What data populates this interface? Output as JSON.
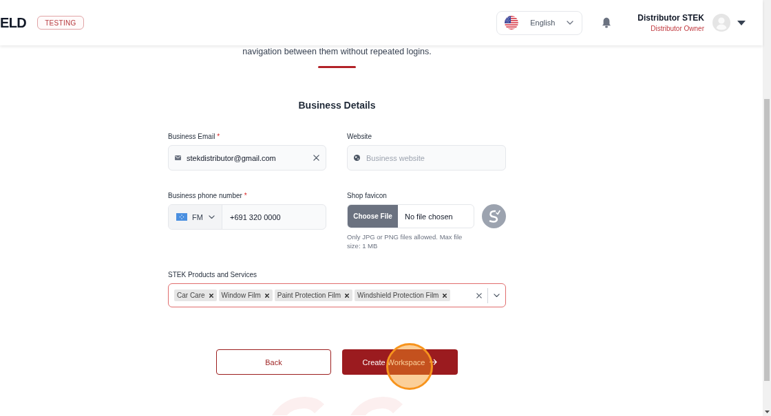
{
  "header": {
    "logo_text": "ELD",
    "environment_badge": "TESTING",
    "language": {
      "label": "English"
    },
    "user": {
      "name": "Distributor STEK",
      "role": "Distributor Owner"
    }
  },
  "intro": {
    "text": "navigation between them without repeated logins."
  },
  "section": {
    "title": "Business Details"
  },
  "email": {
    "label": "Business Email",
    "required_mark": "*",
    "value": "stekdistributor@gmail.com"
  },
  "website": {
    "label": "Website",
    "placeholder": "Business website"
  },
  "phone": {
    "label": "Business phone number",
    "required_mark": "*",
    "country": "FM",
    "value": "+691 320 0000"
  },
  "favicon": {
    "label": "Shop favicon",
    "button": "Choose File",
    "status": "No file chosen",
    "hint": "Only JPG or PNG files allowed. Max file size: 1 MB"
  },
  "products": {
    "label": "STEK Products and Services",
    "focused": true,
    "tags": [
      "Car Care",
      "Window Film",
      "Paint Protection Film",
      "Windshield Protection Film"
    ]
  },
  "buttons": [
    {
      "label": "Back",
      "kind": "secondary"
    },
    {
      "label": "Create Workspace",
      "kind": "primary"
    }
  ]
}
